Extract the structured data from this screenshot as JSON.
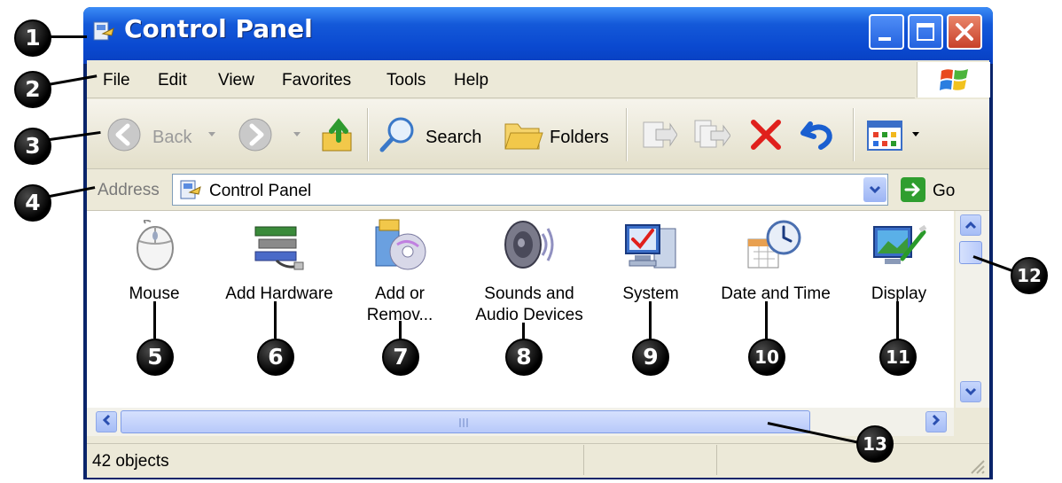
{
  "window": {
    "title": "Control Panel",
    "controls": {
      "minimize": "minimize",
      "maximize": "maximize",
      "close": "close"
    }
  },
  "menubar": {
    "items": [
      "File",
      "Edit",
      "View",
      "Favorites",
      "Tools",
      "Help"
    ]
  },
  "toolbar": {
    "back_label": "Back",
    "search_label": "Search",
    "folders_label": "Folders"
  },
  "addressbar": {
    "label": "Address",
    "value": "Control Panel",
    "go_label": "Go"
  },
  "items": [
    {
      "label1": "Mouse",
      "label2": ""
    },
    {
      "label1": "Add Hardware",
      "label2": ""
    },
    {
      "label1": "Add or",
      "label2": "Remov..."
    },
    {
      "label1": "Sounds and",
      "label2": "Audio Devices"
    },
    {
      "label1": "System",
      "label2": ""
    },
    {
      "label1": "Date and Time",
      "label2": ""
    },
    {
      "label1": "Display",
      "label2": ""
    }
  ],
  "statusbar": {
    "text": "42 objects"
  },
  "callouts": [
    "1",
    "2",
    "3",
    "4",
    "5",
    "6",
    "7",
    "8",
    "9",
    "10",
    "11",
    "12",
    "13"
  ],
  "colors": {
    "titlebar": "#0a49d0",
    "chrome": "#ece9d8",
    "close_button": "#c8412a",
    "delete_x": "#e0201c"
  }
}
